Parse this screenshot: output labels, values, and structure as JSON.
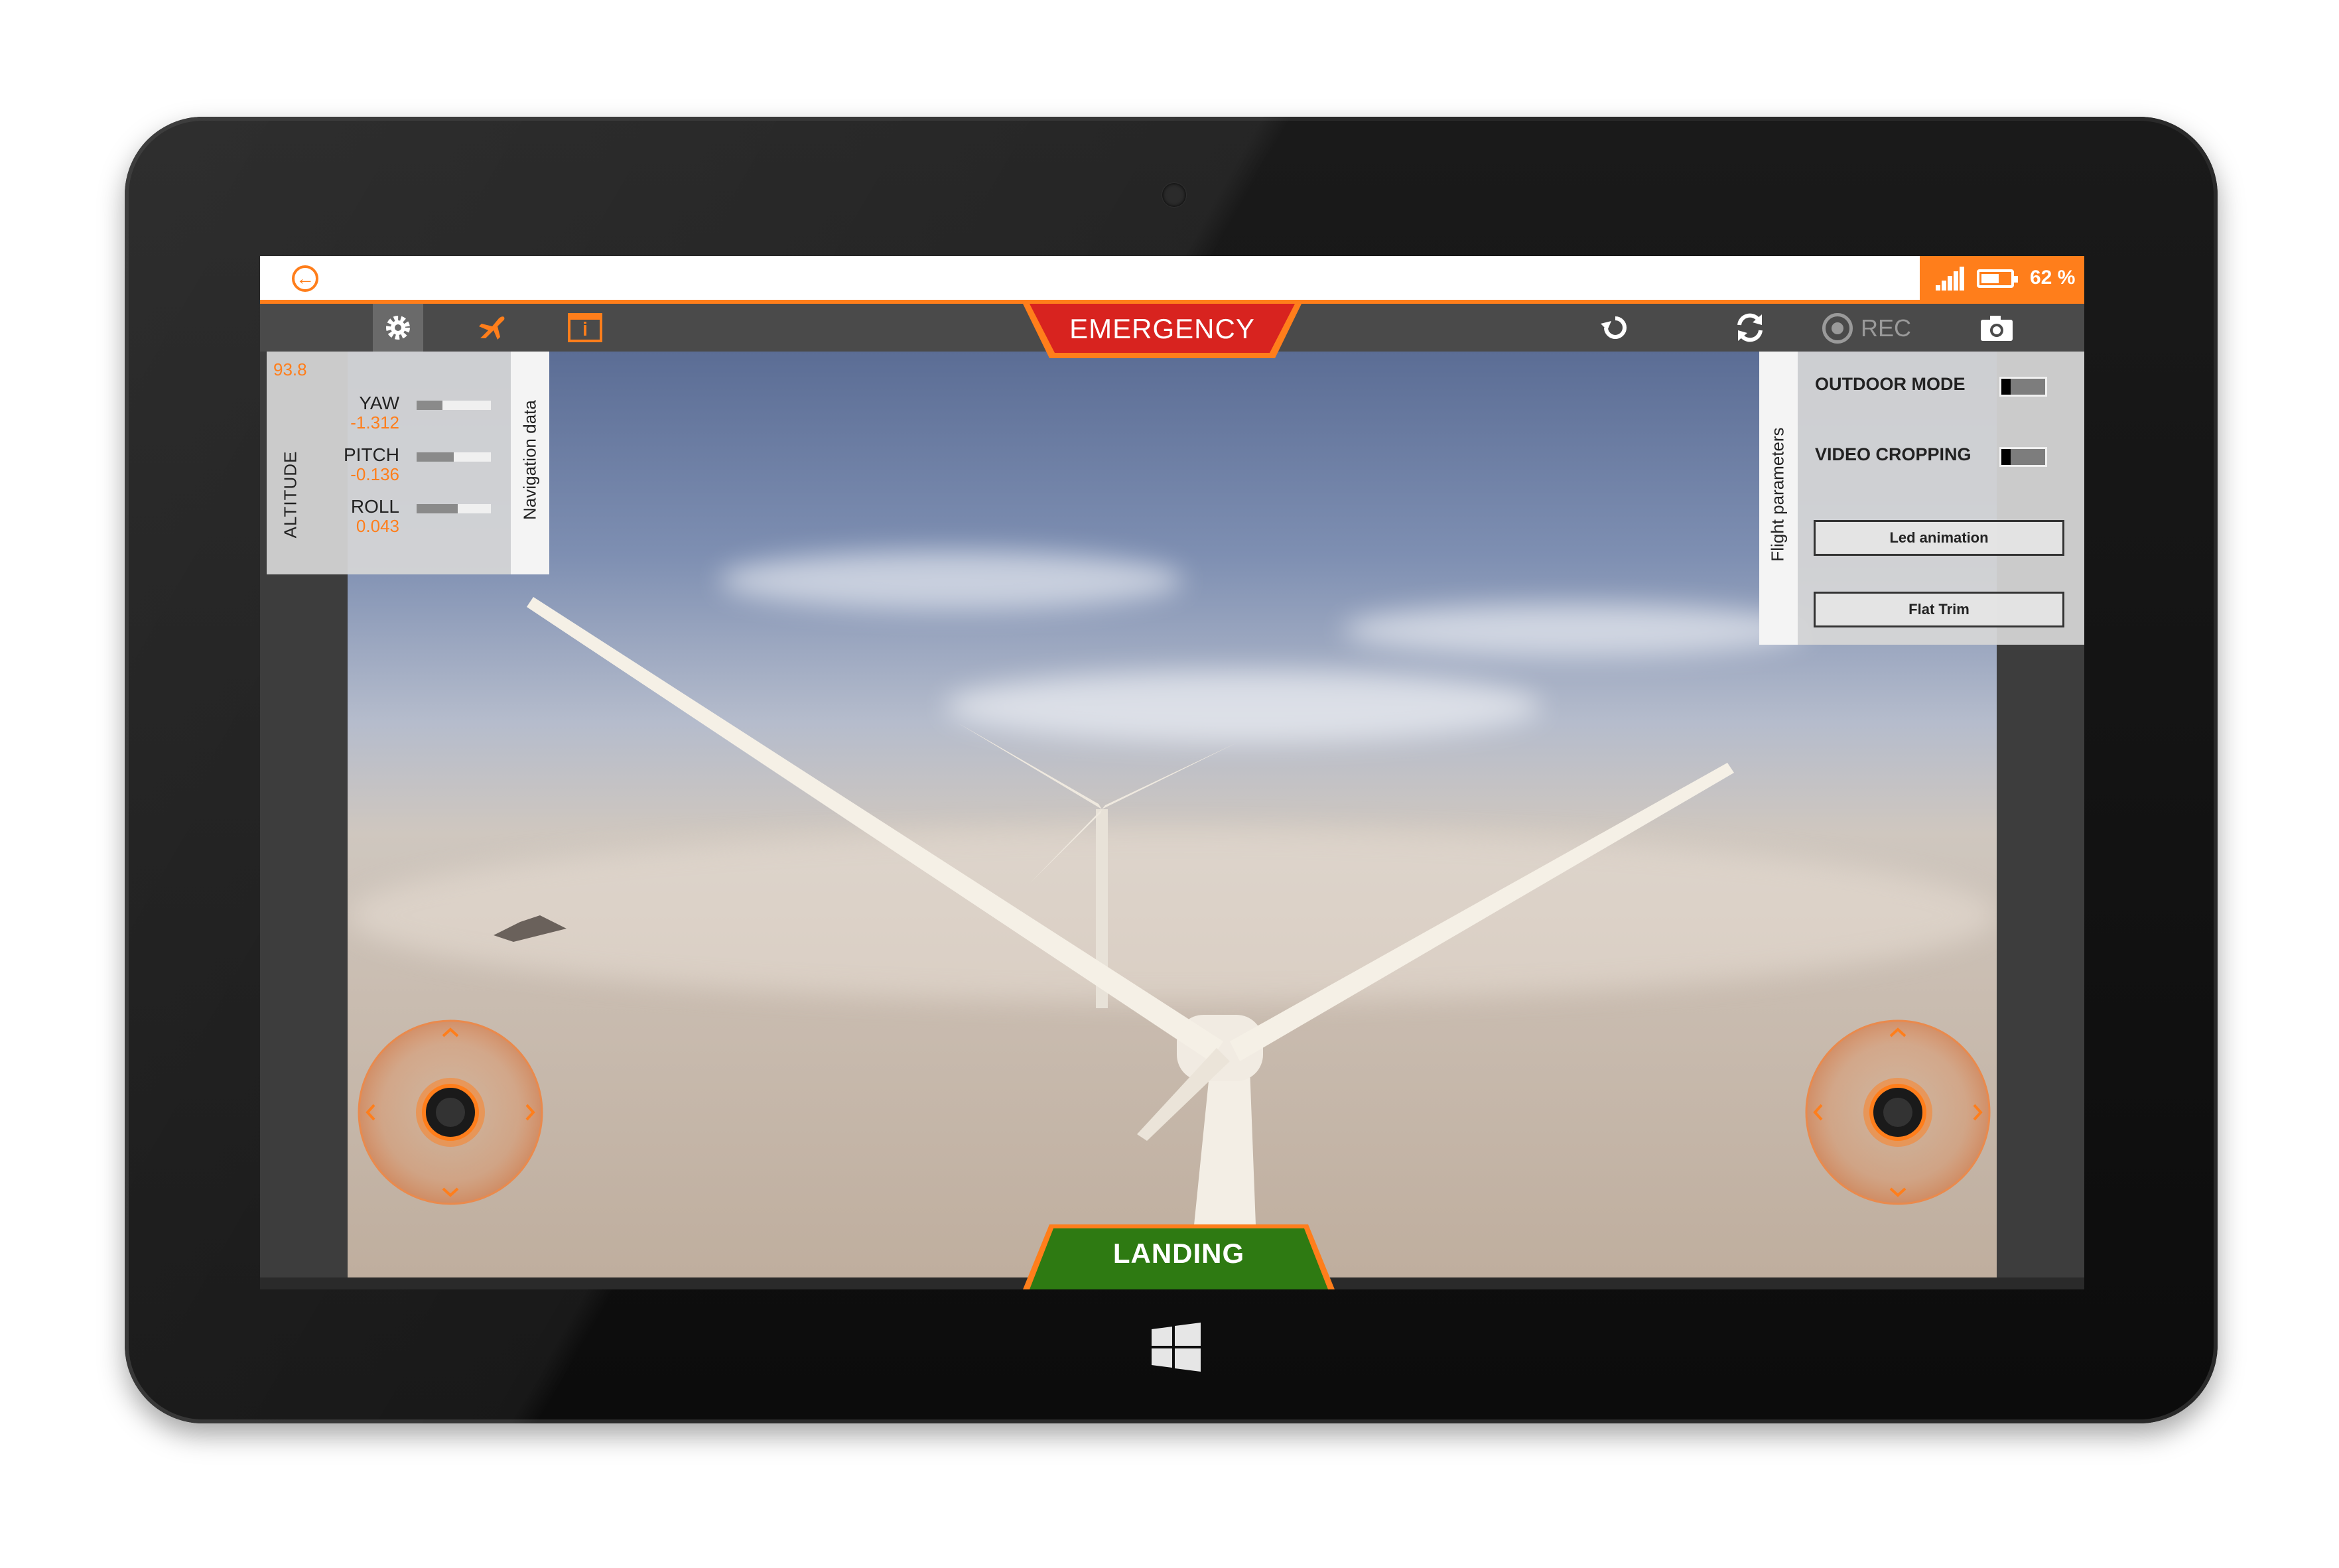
{
  "status": {
    "battery_level": 0.62,
    "battery_text": "62 %"
  },
  "toolbar": {
    "emergency_label": "EMERGENCY",
    "rec_label": "REC",
    "icons": [
      "settings-icon",
      "plane-icon",
      "info-window-icon",
      "undo-icon",
      "refresh-icon",
      "record-icon",
      "camera-icon"
    ]
  },
  "nav_panel": {
    "tab_label": "Navigation data",
    "altitude_label": "ALTITUDE",
    "altitude_value": "93.8",
    "metrics": [
      {
        "label": "YAW",
        "value": "-1.312",
        "level": 0.35
      },
      {
        "label": "PITCH",
        "value": "-0.136",
        "level": 0.5
      },
      {
        "label": "ROLL",
        "value": "0.043",
        "level": 0.55
      }
    ]
  },
  "flight_panel": {
    "tab_label": "Flight parameters",
    "outdoor_mode_label": "OUTDOOR MODE",
    "video_cropping_label": "VIDEO CROPPING",
    "led_animation_label": "Led animation",
    "flat_trim_label": "Flat Trim"
  },
  "landing_label": "LANDING",
  "colors": {
    "accent": "#ff7e1b",
    "emergency": "#d8231f",
    "landing": "#2e7a12",
    "toolbar": "#4a4a4a"
  }
}
